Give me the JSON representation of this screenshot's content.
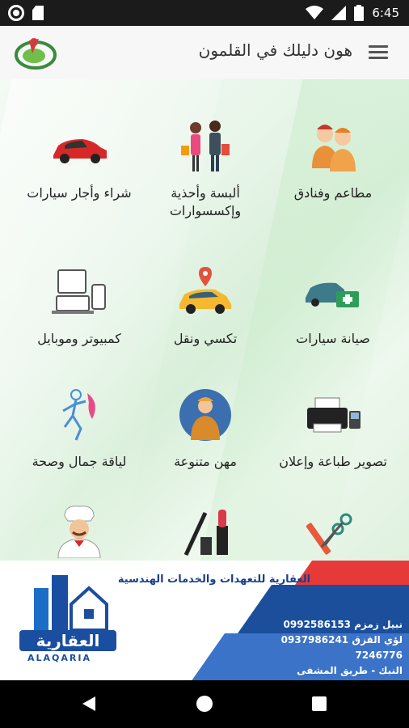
{
  "status_bar": {
    "time": "6:45"
  },
  "app_bar": {
    "title": "هون دليلك في القلمون"
  },
  "categories": [
    {
      "label": "مطاعم وفنادق",
      "icon": "waiters-icon"
    },
    {
      "label": "ألبسة وأحذية وإكسسوارات",
      "icon": "shopping-couple-icon"
    },
    {
      "label": "شراء وأجار سيارات",
      "icon": "red-car-icon"
    },
    {
      "label": "صيانة سيارات",
      "icon": "car-repair-icon"
    },
    {
      "label": "تكسي ونقل",
      "icon": "taxi-icon"
    },
    {
      "label": "كمبيوتر وموبايل",
      "icon": "computer-devices-icon"
    },
    {
      "label": "تصوير طباعة وإعلان",
      "icon": "printer-icon"
    },
    {
      "label": "مهن متنوعة",
      "icon": "worker-icon"
    },
    {
      "label": "لياقة جمال وصحة",
      "icon": "fitness-icon"
    },
    {
      "label": "",
      "icon": "scissors-comb-icon"
    },
    {
      "label": "",
      "icon": "cosmetics-icon"
    },
    {
      "label": "",
      "icon": "chef-icon"
    }
  ],
  "ad": {
    "headline": "العقارية للتعهدات والخدمات الهندسية",
    "contacts": [
      "نبيل زمزم 0992586153",
      "لؤي القزق 0937986241",
      "7246776",
      "النبك - طريق المشفى"
    ],
    "brand": "العقارية",
    "brand_latin": "ALAQARIA"
  },
  "colors": {
    "status_bg": "#1b1b1b",
    "appbar_bg": "#f7f7f7",
    "accent_green": "#d8efd9",
    "ad_blue": "#1a4ea0",
    "ad_red": "#e63a3a"
  }
}
